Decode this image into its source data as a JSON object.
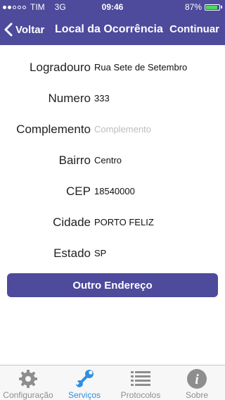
{
  "status_bar": {
    "carrier": "TIM",
    "network": "3G",
    "time": "09:46",
    "battery": "87%",
    "battery_level": 0.87
  },
  "nav": {
    "back_label": "Voltar",
    "title": "Local da Ocorrência",
    "next_label": "Continuar"
  },
  "form": {
    "fields": [
      {
        "label": "Logradouro",
        "value": "Rua Sete de Setembro",
        "placeholder": ""
      },
      {
        "label": "Numero",
        "value": "333",
        "placeholder": ""
      },
      {
        "label": "Complemento",
        "value": "",
        "placeholder": "Complemento"
      },
      {
        "label": "Bairro",
        "value": "Centro",
        "placeholder": ""
      },
      {
        "label": "CEP",
        "value": "18540000",
        "placeholder": ""
      },
      {
        "label": "Cidade",
        "value": "PORTO FELIZ",
        "placeholder": ""
      },
      {
        "label": "Estado",
        "value": "SP",
        "placeholder": ""
      }
    ],
    "button_label": "Outro Endereço"
  },
  "tabbar": {
    "tabs": [
      {
        "label": "Configuração",
        "icon": "gear-icon",
        "active": false
      },
      {
        "label": "Serviços",
        "icon": "wrench-icon",
        "active": true
      },
      {
        "label": "Protocolos",
        "icon": "list-icon",
        "active": false
      },
      {
        "label": "Sobre",
        "icon": "info-icon",
        "active": false
      }
    ]
  },
  "colors": {
    "brand": "#4e4a9c",
    "active_tab": "#2f8fe0",
    "inactive_tab": "#8e8e8e",
    "battery": "#4cd964"
  }
}
